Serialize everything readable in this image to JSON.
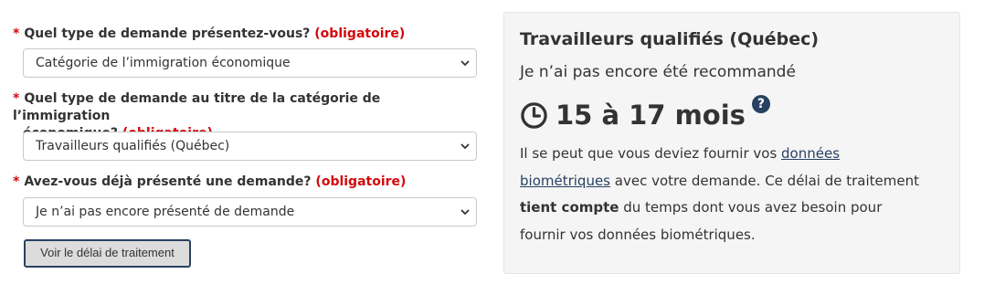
{
  "form": {
    "required_marker": "*",
    "questions": [
      {
        "label": "Quel type de demande présentez-vous?",
        "required": "(obligatoire)",
        "value": "Catégorie de l’immigration économique"
      },
      {
        "label_line1": "Quel type de demande au titre de la catégorie de l’immigration",
        "label_line2": "économique?",
        "required": "(obligatoire)",
        "value": "Travailleurs qualifiés (Québec)"
      },
      {
        "label": "Avez-vous déjà présenté une demande?",
        "required": "(obligatoire)",
        "value": "Je n’ai pas encore présenté de demande"
      }
    ],
    "submit_label": "Voir le délai de traitement"
  },
  "result": {
    "title": "Travailleurs qualifiés (Québec)",
    "status": "Je n’ai pas encore été recommandé",
    "time": "15 à 17 mois",
    "help_icon": "question-circle-icon",
    "clock_icon": "clock-icon",
    "note": {
      "part1": "Il se peut que vous deviez fournir vos ",
      "link_line1": "données",
      "link_line2": "biométriques",
      "part2": " avec votre demande. Ce délai de traitement ",
      "bold": "tient compte",
      "part3": " du temps dont vous avez besoin pour fournir vos données biométriques."
    }
  },
  "colors": {
    "required_red": "#d3080c",
    "link_blue": "#284162",
    "panel_bg": "#f5f5f5"
  }
}
